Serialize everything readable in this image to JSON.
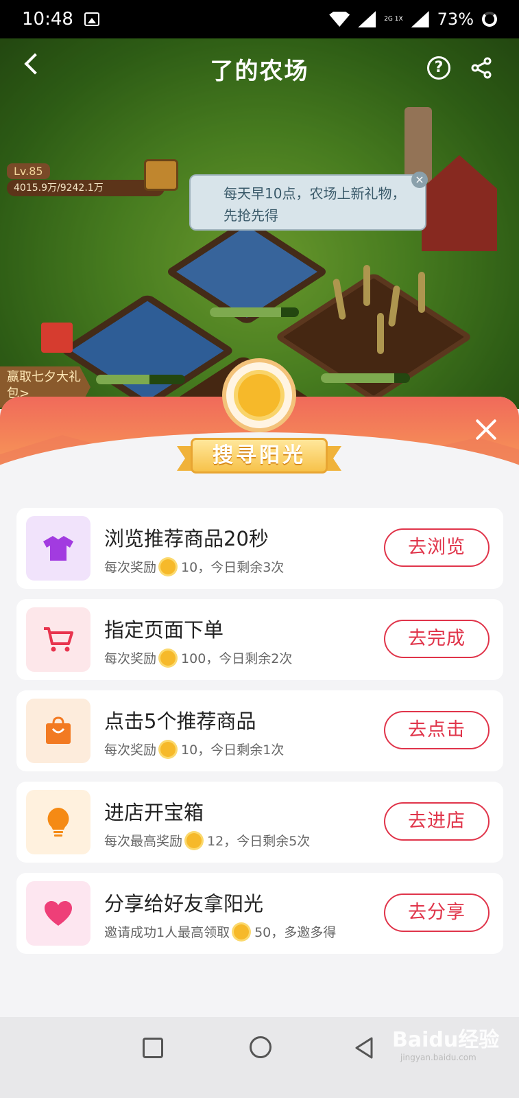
{
  "status_bar": {
    "time": "10:48",
    "network": "2G 1X",
    "battery": "73%"
  },
  "header": {
    "title": "了的农场"
  },
  "farm": {
    "level": "Lv.85",
    "xp": "4015.9万/9242.1万",
    "tip": "每天早10点，农场上新礼物，先抢先得",
    "event_label": "赢取七夕大礼包>"
  },
  "sheet": {
    "title": "搜寻阳光"
  },
  "tasks": [
    {
      "name": "浏览推荐商品20秒",
      "reward_prefix": "每次奖励",
      "reward_suffix": "10，今日剩余3次",
      "button": "去浏览",
      "icon": "tshirt-icon",
      "icon_bg": "#f1e3fb",
      "icon_color": "#a23be0"
    },
    {
      "name": "指定页面下单",
      "reward_prefix": "每次奖励",
      "reward_suffix": "100，今日剩余2次",
      "button": "去完成",
      "icon": "cart-icon",
      "icon_bg": "#fde7ea",
      "icon_color": "#e8344e"
    },
    {
      "name": "点击5个推荐商品",
      "reward_prefix": "每次奖励",
      "reward_suffix": "10，今日剩余1次",
      "button": "去点击",
      "icon": "shopping-bag-icon",
      "icon_bg": "#fdecdc",
      "icon_color": "#f27a22"
    },
    {
      "name": "进店开宝箱",
      "reward_prefix": "每次最高奖励",
      "reward_suffix": "12，今日剩余5次",
      "button": "去进店",
      "icon": "lightbulb-icon",
      "icon_bg": "#fff1de",
      "icon_color": "#f58a14"
    },
    {
      "name": "分享给好友拿阳光",
      "reward_prefix": "邀请成功1人最高领取",
      "reward_suffix": "50，多邀多得",
      "button": "去分享",
      "icon": "heart-icon",
      "icon_bg": "#fde6f0",
      "icon_color": "#ee3f78"
    }
  ],
  "watermark": {
    "text": "Baidu经验",
    "sub": "jingyan.baidu.com"
  },
  "colors": {
    "accent": "#e0344a",
    "sun": "#f6b92a"
  }
}
